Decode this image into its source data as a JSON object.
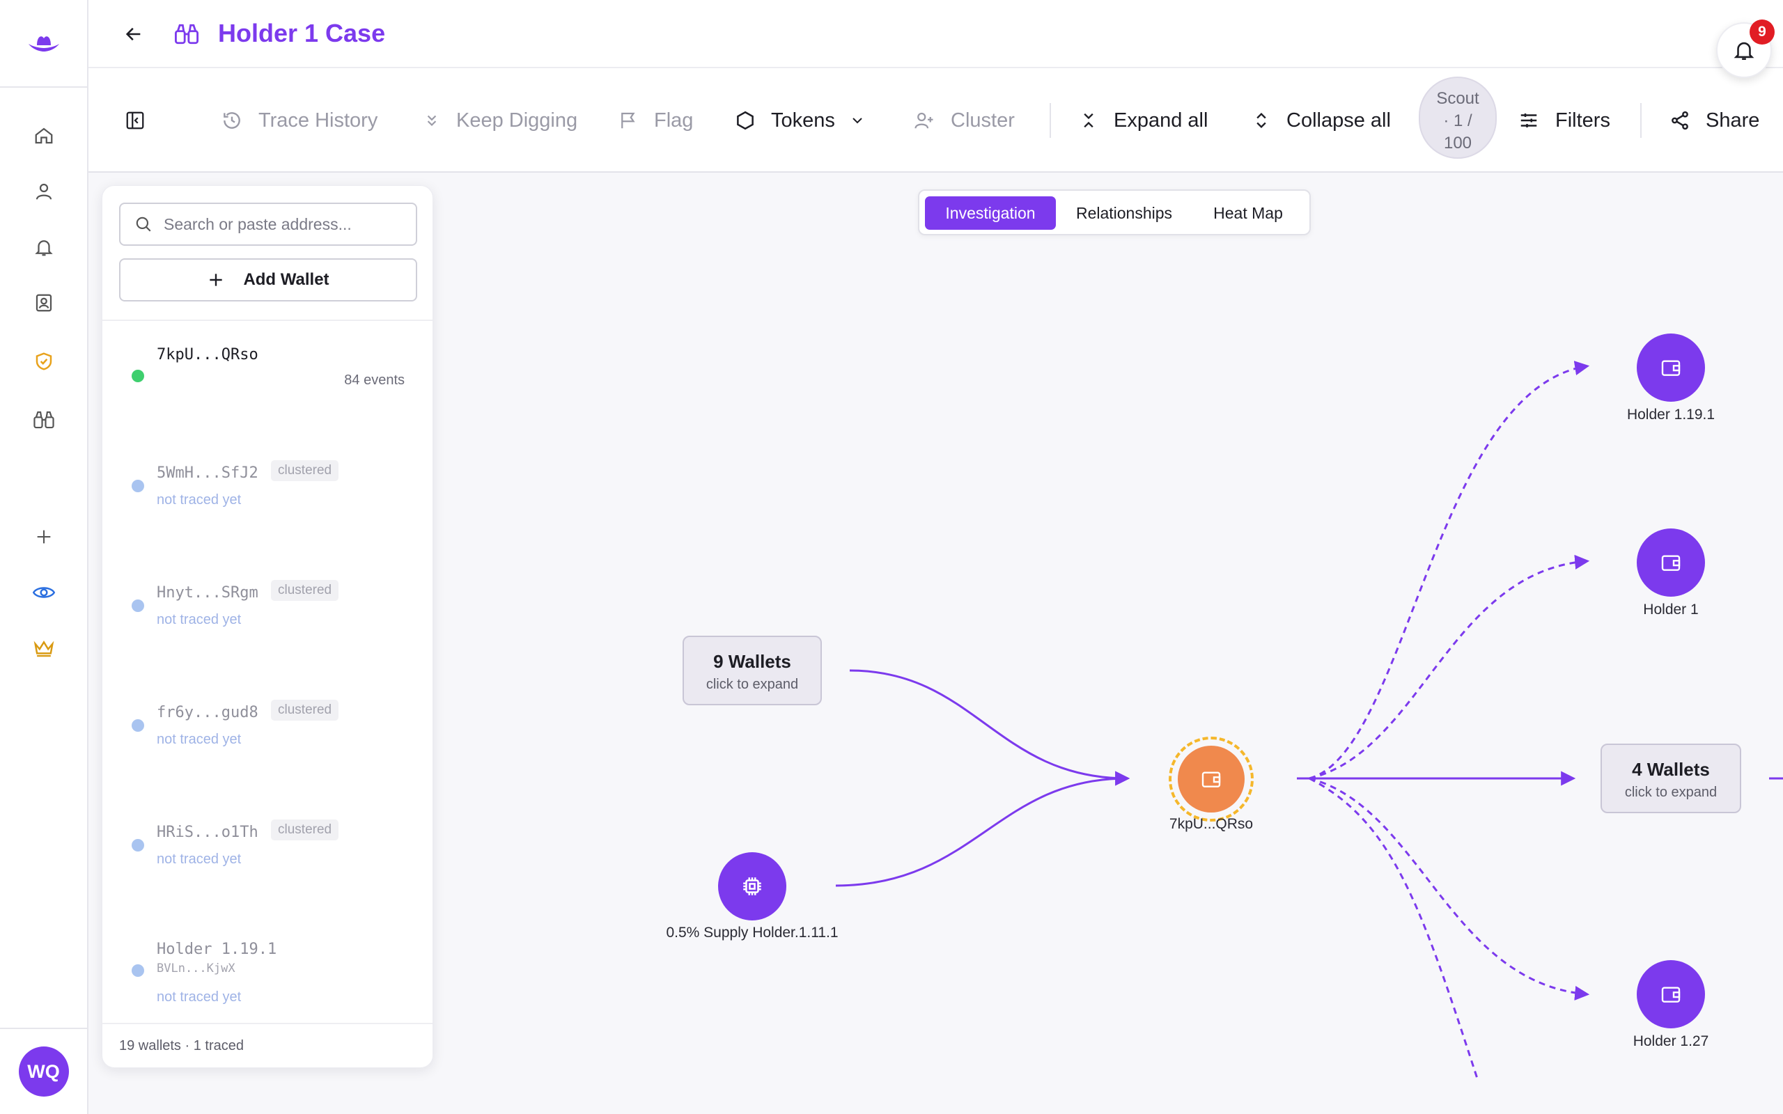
{
  "header": {
    "title": "Holder 1 Case",
    "notification_count": "9"
  },
  "toolbar": {
    "trace_history": "Trace History",
    "keep_digging": "Keep Digging",
    "flag": "Flag",
    "tokens": "Tokens",
    "cluster": "Cluster",
    "expand_all": "Expand all",
    "collapse_all": "Collapse all",
    "scout_line1": "Scout",
    "scout_line2": "· 1 /",
    "scout_line3": "100",
    "filters": "Filters",
    "share": "Share"
  },
  "sidebar": {
    "avatar_initials": "WQ"
  },
  "panel": {
    "search_placeholder": "Search or paste address...",
    "add_wallet": "Add Wallet",
    "wallets": [
      {
        "address": "7kpU...QRso",
        "events": "84 events"
      },
      {
        "address": "5WmH...SfJ2",
        "tag": "clustered",
        "status": "not traced yet"
      },
      {
        "address": "Hnyt...SRgm",
        "tag": "clustered",
        "status": "not traced yet"
      },
      {
        "address": "fr6y...gud8",
        "tag": "clustered",
        "status": "not traced yet"
      },
      {
        "address": "HRiS...o1Th",
        "tag": "clustered",
        "status": "not traced yet"
      },
      {
        "address": "Holder 1.19.1",
        "sub_address": "BVLn...KjwX",
        "status": "not traced yet"
      }
    ],
    "footer": "19 wallets · 1 traced"
  },
  "view_tabs": [
    "Investigation",
    "Relationships",
    "Heat Map"
  ],
  "graph": {
    "group_left": {
      "title": "9 Wallets",
      "hint": "click to expand"
    },
    "group_right": {
      "title": "4 Wallets",
      "hint": "click to expand"
    },
    "supply_node": "0.5% Supply Holder.1.11.1",
    "center_node": "7kpU...QRso",
    "holder_a": "Holder 1.19.1",
    "holder_b": "Holder 1",
    "holder_c": "Holder 1.27"
  },
  "colors": {
    "accent": "#7c3aed",
    "center": "#f0894d",
    "ring": "#f5b72b",
    "traced": "#3ecf6e",
    "untraced": "#a9c4f0"
  }
}
